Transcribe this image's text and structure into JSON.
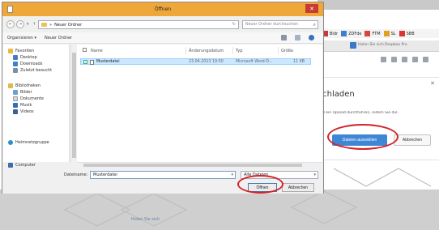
{
  "dialog": {
    "title": "Öffnen",
    "close_glyph": "✕",
    "address": {
      "root_glyph": "»",
      "path": "Neuer Ordner",
      "refresh_glyph": "↻"
    },
    "search": {
      "placeholder": "Neuer Ordner durchsuchen",
      "icon_glyph": "⌕"
    },
    "toolbar": {
      "organize": "Organisieren ▾",
      "new_folder": "Neuer Ordner"
    },
    "sidebar": {
      "favorites": "Favoriten",
      "desktop": "Desktop",
      "downloads": "Downloads",
      "recent": "Zuletzt besucht",
      "libraries": "Bibliotheken",
      "pictures": "Bilder",
      "documents": "Dokumente",
      "music": "Musik",
      "videos": "Videos",
      "homegroup": "Heimnetzgruppe",
      "computer": "Computer"
    },
    "columns": {
      "name": "Name",
      "date": "Änderungsdatum",
      "type": "Typ",
      "size": "Größe"
    },
    "files": [
      {
        "name": "Musterdatei",
        "date": "23.04.2013 19:50",
        "type": "Microsoft Word-D...",
        "size": "11 KB"
      }
    ],
    "footer": {
      "filename_label": "Dateiname:",
      "filename_value": "Musterdatei",
      "filetype": "Alle Dateien",
      "open_button": "Öffnen",
      "cancel_button": "Abbrechen"
    }
  },
  "background": {
    "bookmarks": [
      "Bldr",
      "ZDFde",
      "FTM",
      "SL",
      "SBB"
    ],
    "promo": "Holen Sie sich Dropbox Pro",
    "upload": {
      "title": "ochladen",
      "description": "und ein Upload durchführen, indem Sie die",
      "choose_button": "Dateien auswählen",
      "cancel_button": "Abbrechen"
    },
    "lower_text": "Holen Sie sich"
  },
  "colors": {
    "titlebar": "#f0a73a",
    "selection": "#cce8ff",
    "primary_button": "#3f86d5",
    "highlight_ring": "#d2232a"
  }
}
